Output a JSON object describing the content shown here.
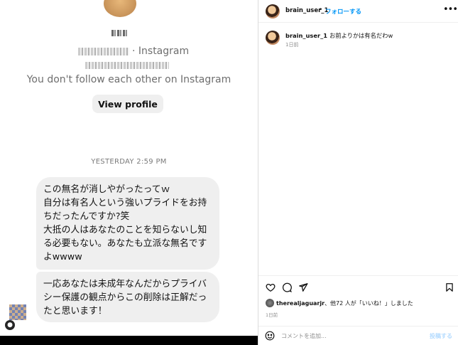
{
  "dm": {
    "ig_suffix": "· Instagram",
    "follow_status": "You don't follow each other on Instagram",
    "view_profile_label": "View profile",
    "timestamp": "YESTERDAY 2:59 PM",
    "messages": [
      {
        "lines": [
          "この無名が消しやがったってｗ",
          "自分は有名人という強いプライドをお持ちだったんですか?笑",
          "大抵の人はあなたのことを知らないし知る必要もない。あなたも立派な無名ですよwwww"
        ]
      },
      {
        "lines": [
          "一応あなたは未成年なんだからプライバシー保護の観点からこの削除は正解だったと思います！"
        ]
      }
    ]
  },
  "post": {
    "username": "brain_user_1",
    "separator": "•",
    "follow_label": "フォローする",
    "more_icon": "more-horizontal-icon",
    "caption_user": "brain_user_1",
    "caption_text": "お前よりかは有名だわw",
    "caption_time": "1日前",
    "likes_user": "therealjaguarjr",
    "likes_rest": "、他72 人が「いいね！」しました",
    "post_time": "1日前",
    "comment_placeholder": "コメントを追加...",
    "post_label": "投稿する"
  },
  "colors": {
    "accent": "#0095f6",
    "bubble": "#efefef",
    "muted": "#8e8e8e"
  }
}
